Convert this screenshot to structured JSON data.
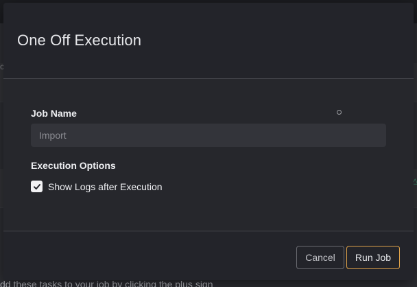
{
  "background": {
    "fragment_left": "c",
    "bottom_text": "dd these tasks to your job by clicking the plus sign",
    "accent_glyph": "△"
  },
  "modal": {
    "title": "One Off Execution",
    "job_name": {
      "label": "Job Name",
      "placeholder": "Import",
      "value": ""
    },
    "execution_options": {
      "label": "Execution Options",
      "show_logs": {
        "label": "Show Logs after Execution",
        "checked": true
      }
    },
    "buttons": {
      "cancel": "Cancel",
      "run": "Run Job"
    }
  },
  "colors": {
    "accent_border": "#e1a44a",
    "modal_bg": "#23242a",
    "input_bg": "#33343a"
  },
  "icons": [
    "check-icon",
    "cursor-icon",
    "warning-icon"
  ]
}
